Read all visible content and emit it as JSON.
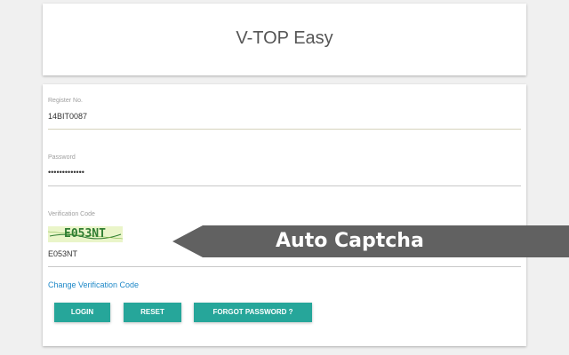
{
  "header": {
    "title": "V-TOP Easy"
  },
  "form": {
    "register": {
      "label": "Register No.",
      "value": "14BIT0087"
    },
    "password": {
      "label": "Password",
      "value": "•••••••••••••"
    },
    "verification": {
      "label": "Verification Code",
      "captcha_text": "E053NT",
      "value": "E053NT"
    },
    "change_link": "Change Verification Code",
    "buttons": {
      "login": "LOGIN",
      "reset": "RESET",
      "forgot": "FORGOT PASSWORD ?"
    }
  },
  "banner": {
    "text": "Auto Captcha",
    "color": "#616161"
  },
  "colors": {
    "accent": "#26a69a",
    "link": "#1e88c8"
  }
}
